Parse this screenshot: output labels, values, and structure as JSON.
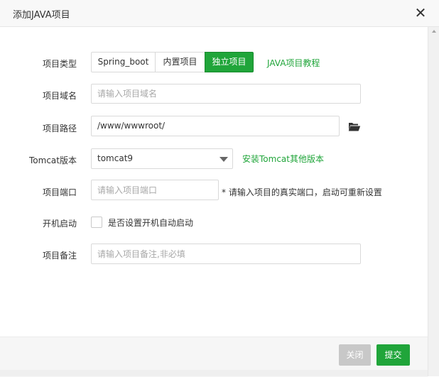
{
  "dialog": {
    "title": "添加JAVA项目",
    "close_glyph": "✕"
  },
  "form": {
    "project_type": {
      "label": "项目类型",
      "options": [
        "Spring_boot",
        "内置项目",
        "独立项目"
      ],
      "selected": "独立项目",
      "tutorial_link": "JAVA项目教程"
    },
    "domain": {
      "label": "项目域名",
      "placeholder": "请输入项目域名",
      "value": ""
    },
    "path": {
      "label": "项目路径",
      "value": "/www/wwwroot/",
      "browse_icon": "folder-open-icon"
    },
    "tomcat": {
      "label": "Tomcat版本",
      "selected": "tomcat9",
      "install_link": "安装Tomcat其他版本"
    },
    "port": {
      "label": "项目端口",
      "placeholder": "请输入项目端口",
      "hint": "* 请输入项目的真实端口，启动可重新设置"
    },
    "autostart": {
      "label": "开机启动",
      "checkbox_label": "是否设置开机自动启动",
      "checked": false
    },
    "remark": {
      "label": "项目备注",
      "placeholder": "请输入项目备注,非必填"
    }
  },
  "footer": {
    "close_label": "关闭",
    "submit_label": "提交"
  },
  "colors": {
    "accent": "#20a53a",
    "disabled": "#c8c8c8"
  }
}
